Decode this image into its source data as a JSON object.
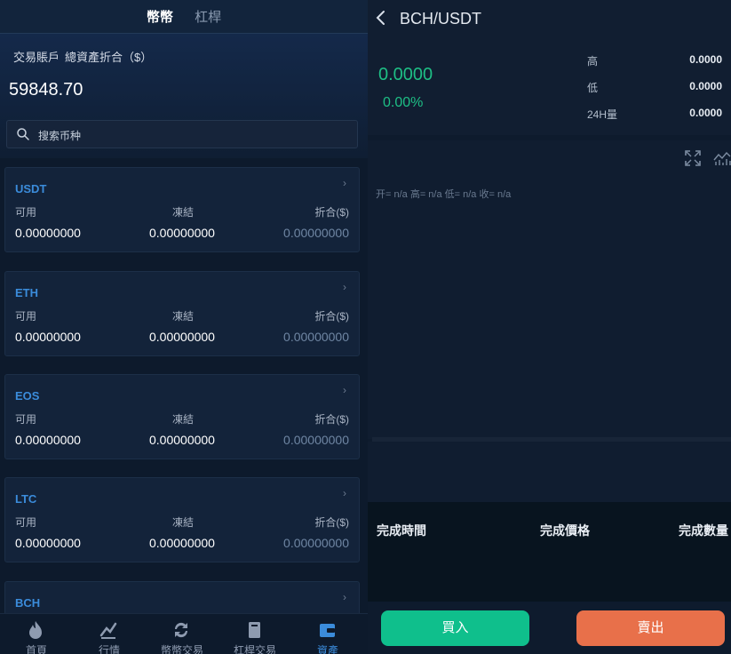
{
  "left_panel": {
    "tabs": [
      "幣幣",
      "杠桿"
    ],
    "account_label": "交易賬戶",
    "account_sub_label": "總資產折合（$）",
    "total_value": "59848.70",
    "search_placeholder": "搜索币种",
    "column_labels": {
      "available": "可用",
      "frozen": "凍結",
      "converted": "折合($)"
    },
    "assets": [
      {
        "symbol": "USDT",
        "available": "0.00000000",
        "frozen": "0.00000000",
        "converted": "0.00000000"
      },
      {
        "symbol": "ETH",
        "available": "0.00000000",
        "frozen": "0.00000000",
        "converted": "0.00000000"
      },
      {
        "symbol": "EOS",
        "available": "0.00000000",
        "frozen": "0.00000000",
        "converted": "0.00000000"
      },
      {
        "symbol": "LTC",
        "available": "0.00000000",
        "frozen": "0.00000000",
        "converted": "0.00000000"
      },
      {
        "symbol": "BCH"
      }
    ],
    "bottom_nav": [
      {
        "label": "首頁",
        "icon": "flame-icon"
      },
      {
        "label": "行情",
        "icon": "chart-icon"
      },
      {
        "label": "幣幣交易",
        "icon": "exchange-icon"
      },
      {
        "label": "杠桿交易",
        "icon": "book-icon"
      },
      {
        "label": "資產",
        "icon": "wallet-icon",
        "active": true
      }
    ]
  },
  "right_panel": {
    "back_icon": "chevron-left-icon",
    "pair": "BCH/USDT",
    "price": "0.0000",
    "change": "0.00%",
    "stats": [
      {
        "label": "高",
        "value": "0.0000"
      },
      {
        "label": "低",
        "value": "0.0000"
      },
      {
        "label": "24H量",
        "value": "0.0000"
      }
    ],
    "ohlc_text": "开= n/a  高= n/a  低= n/a  收= n/a",
    "trade_headers": [
      "完成時間",
      "完成價格",
      "完成數量"
    ],
    "buy_label": "買入",
    "sell_label": "賣出"
  },
  "colors": {
    "accent_blue": "#3b8cdb",
    "up_green": "#1ebf85",
    "buy_green": "#0fbf8c",
    "sell_orange": "#e8704a",
    "background": "#0d1a2c"
  }
}
